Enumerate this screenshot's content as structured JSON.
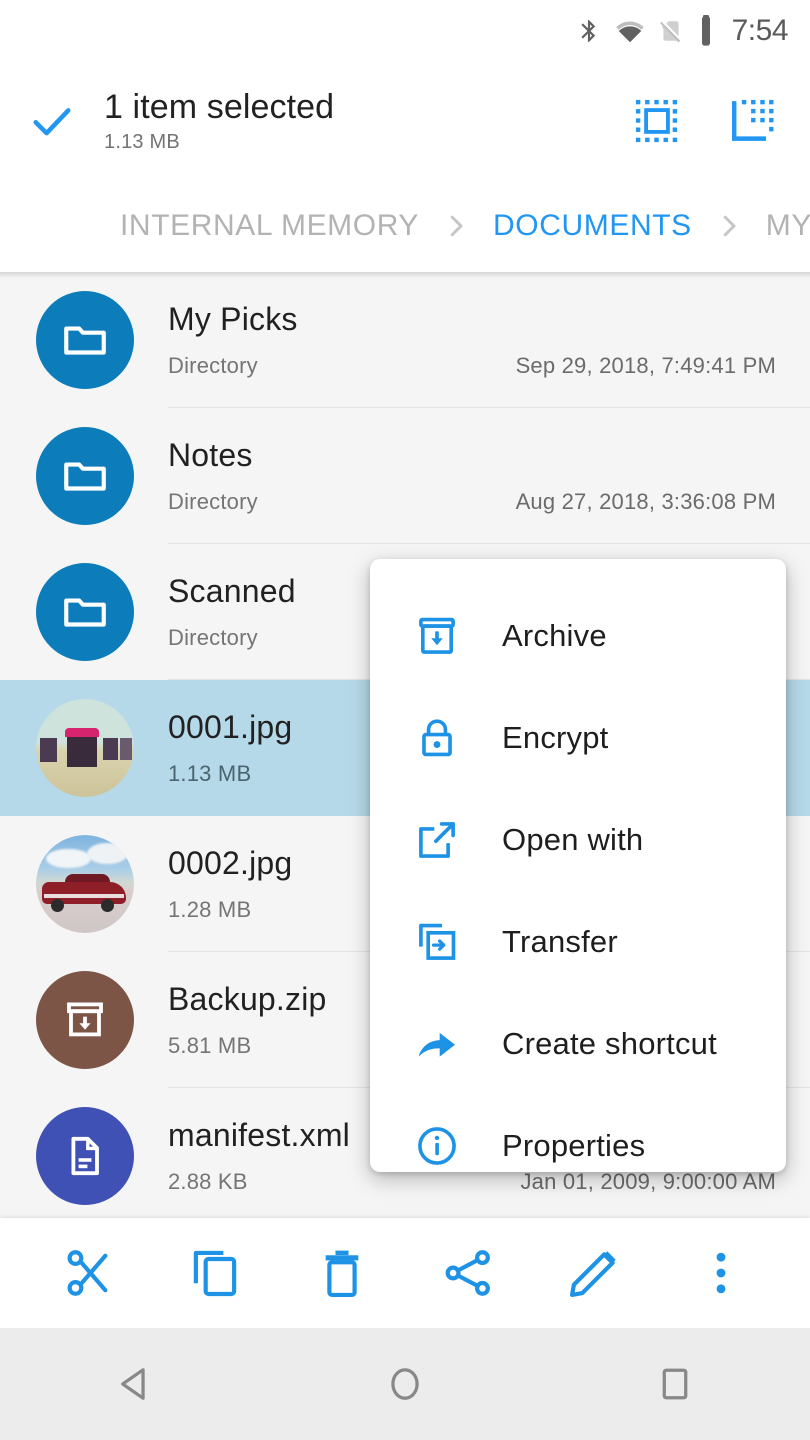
{
  "status_bar": {
    "time": "7:54",
    "icons": [
      "bluetooth-icon",
      "wifi-icon",
      "no-sim-icon",
      "battery-icon"
    ]
  },
  "app_bar": {
    "check_icon": "check-icon",
    "title": "1 item selected",
    "subtitle": "1.13 MB",
    "actions": [
      {
        "name": "select-all-button",
        "icon": "select-all-icon"
      },
      {
        "name": "invert-selection-button",
        "icon": "invert-selection-icon"
      }
    ]
  },
  "breadcrumb": {
    "items": [
      {
        "label": "INTERNAL MEMORY",
        "active": false
      },
      {
        "label": "DOCUMENTS",
        "active": true
      },
      {
        "label": "MY P",
        "active": false
      }
    ],
    "separator": "chevron-right-icon",
    "active_color": "#2196f3",
    "inactive_color": "#b3b3b3"
  },
  "file_list": {
    "rows": [
      {
        "name": "My Picks",
        "meta": "Directory",
        "date": "Sep 29, 2018, 7:49:41 PM",
        "kind": "folder",
        "selected": false
      },
      {
        "name": "Notes",
        "meta": "Directory",
        "date": "Aug 27, 2018, 3:36:08 PM",
        "kind": "folder",
        "selected": false
      },
      {
        "name": "Scanned",
        "meta": "Directory",
        "date": "",
        "kind": "folder",
        "selected": false
      },
      {
        "name": "0001.jpg",
        "meta": "1.13 MB",
        "date": "",
        "kind": "image-beach",
        "selected": true
      },
      {
        "name": "0002.jpg",
        "meta": "1.28 MB",
        "date": "",
        "kind": "image-car",
        "selected": false
      },
      {
        "name": "Backup.zip",
        "meta": "5.81 MB",
        "date": "",
        "kind": "zip",
        "selected": false
      },
      {
        "name": "manifest.xml",
        "meta": "2.88 KB",
        "date": "Jan 01, 2009, 9:00:00 AM",
        "kind": "xml",
        "selected": false
      }
    ],
    "selected_row_color": "#b6d9e9",
    "folder_icon_color": "#0c7cba",
    "zip_icon_color": "#7c5547",
    "xml_icon_color": "#3f51b5"
  },
  "context_menu": {
    "accent_color": "#2196f3",
    "items": [
      {
        "label": "Archive",
        "icon": "archive-icon"
      },
      {
        "label": "Encrypt",
        "icon": "lock-icon"
      },
      {
        "label": "Open with",
        "icon": "open-in-new-icon"
      },
      {
        "label": "Transfer",
        "icon": "transfer-icon"
      },
      {
        "label": "Create shortcut",
        "icon": "shortcut-arrow-icon"
      },
      {
        "label": "Properties",
        "icon": "info-icon"
      }
    ]
  },
  "bottom_bar": {
    "accent_color": "#2196f3",
    "actions": [
      {
        "name": "cut-button",
        "icon": "scissors-icon"
      },
      {
        "name": "copy-button",
        "icon": "copy-icon"
      },
      {
        "name": "delete-button",
        "icon": "trash-icon"
      },
      {
        "name": "share-button",
        "icon": "share-icon"
      },
      {
        "name": "rename-button",
        "icon": "pencil-icon"
      },
      {
        "name": "more-button",
        "icon": "more-vertical-icon"
      }
    ]
  },
  "nav_bar": {
    "buttons": [
      {
        "name": "nav-back-button",
        "icon": "triangle-back-icon"
      },
      {
        "name": "nav-home-button",
        "icon": "circle-home-icon"
      },
      {
        "name": "nav-recents-button",
        "icon": "square-recents-icon"
      }
    ]
  }
}
